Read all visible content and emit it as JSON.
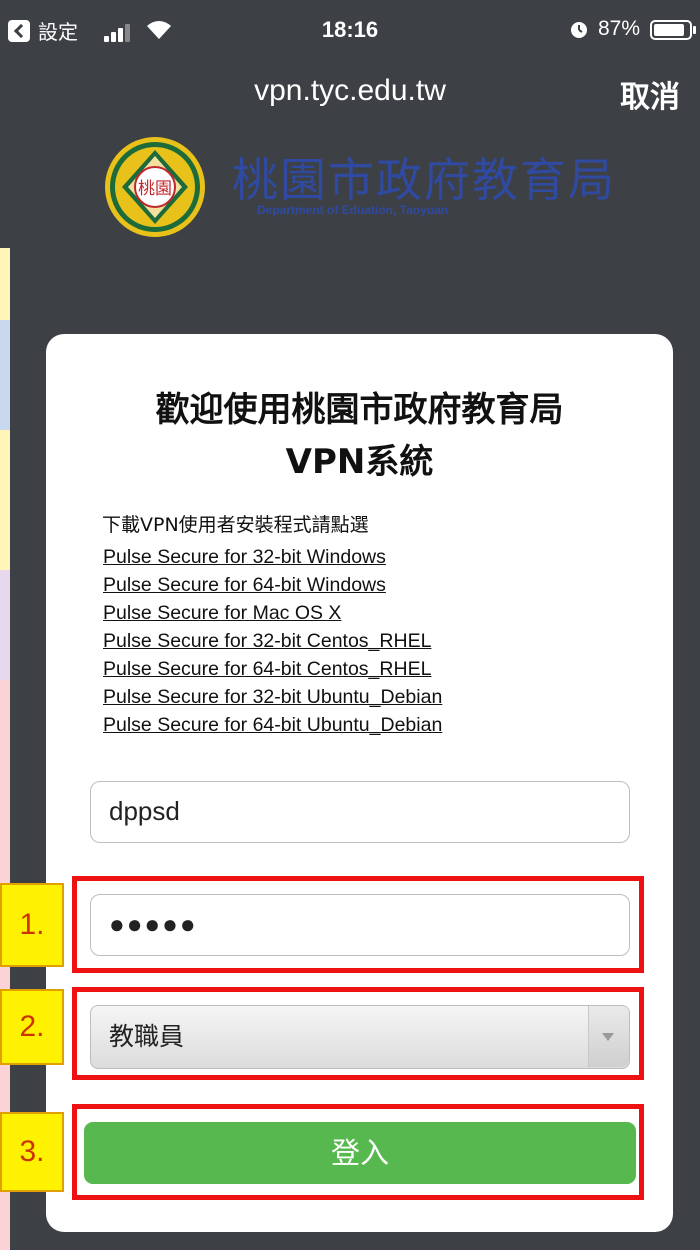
{
  "status_bar": {
    "back_label": "設定",
    "time": "18:16",
    "battery": "87%",
    "battery_level": 0.87
  },
  "nav": {
    "url": "vpn.tyc.edu.tw",
    "cancel": "取消"
  },
  "header": {
    "seal_text": "桃園",
    "title": "桃園市政府教育局",
    "subtitle": "Department of Eduation,  Taoyuan"
  },
  "card": {
    "title_line1": "歡迎使用桃園市政府教育局",
    "title_line2": "VPN系統",
    "download_label": "下載VPN使用者安裝程式請點選",
    "links": [
      "Pulse Secure for 32-bit Windows",
      "Pulse Secure for 64-bit Windows",
      "Pulse Secure for Mac OS X",
      "Pulse Secure for 32-bit Centos_RHEL",
      "Pulse Secure for 64-bit Centos_RHEL",
      "Pulse Secure for 32-bit Ubuntu_Debian",
      "Pulse Secure for 64-bit Ubuntu_Debian"
    ],
    "username": "dppsd",
    "password_mask": "●●●●●",
    "role": "教職員",
    "login": "登入"
  },
  "annotations": [
    "1.",
    "2.",
    "3."
  ],
  "colors": {
    "background": "#3d4044",
    "header_blue": "#2f4aa0",
    "login_green": "#56b84f",
    "annotation_red": "#ee1111",
    "annotation_yellow": "#fff200"
  }
}
